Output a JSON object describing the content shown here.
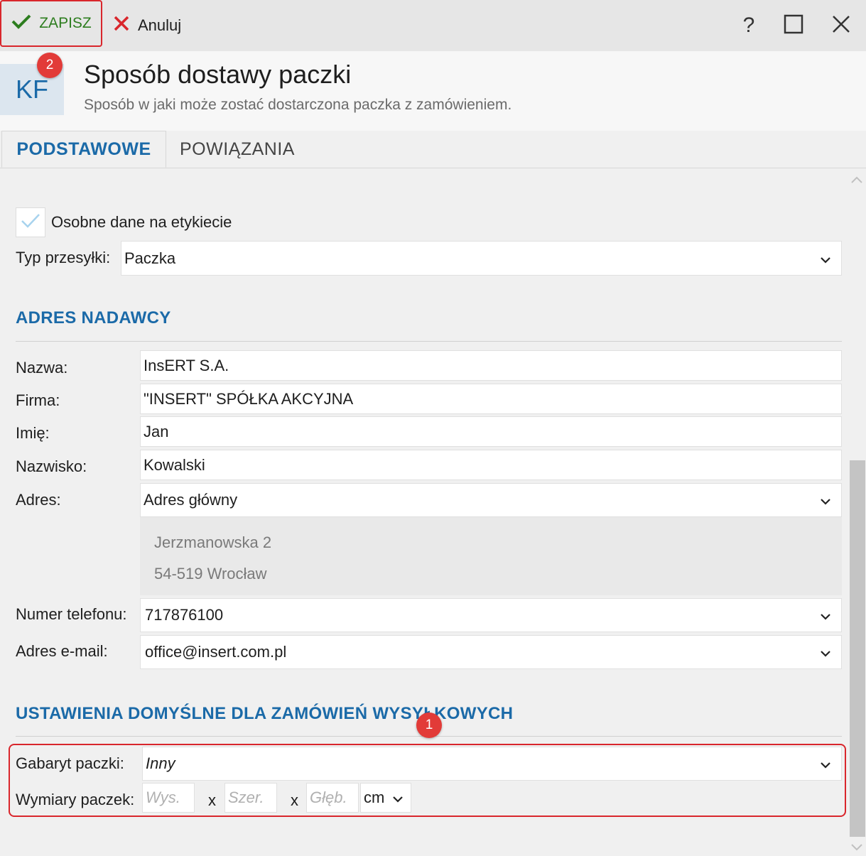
{
  "toolbar": {
    "save_label": "ZAPISZ",
    "cancel_label": "Anuluj"
  },
  "window_controls": {
    "help": "?"
  },
  "header": {
    "avatar_text": "KF",
    "title": "Sposób dostawy paczki",
    "subtitle": "Sposób w jaki może zostać dostarczona paczka z zamówieniem."
  },
  "badges": {
    "save_badge": "2",
    "section_badge": "1"
  },
  "tabs": [
    {
      "label": "PODSTAWOWE",
      "active": true
    },
    {
      "label": "POWIĄZANIA",
      "active": false
    }
  ],
  "general": {
    "separate_data_label": "Osobne dane na etykiecie",
    "separate_data_checked": true,
    "shipment_type_label": "Typ przesyłki:",
    "shipment_type_value": "Paczka"
  },
  "sender": {
    "section_title": "ADRES NADAWCY",
    "name_label": "Nazwa:",
    "name_value": "InsERT S.A.",
    "company_label": "Firma:",
    "company_value": "\"INSERT\" SPÓŁKA AKCYJNA",
    "first_name_label": "Imię:",
    "first_name_value": "Jan",
    "last_name_label": "Nazwisko:",
    "last_name_value": "Kowalski",
    "address_label": "Adres:",
    "address_value": "Adres główny",
    "address_line1": "Jerzmanowska 2",
    "address_line2": "54-519 Wrocław",
    "phone_label": "Numer telefonu:",
    "phone_value": "717876100",
    "email_label": "Adres e-mail:",
    "email_value": "office@insert.com.pl"
  },
  "defaults": {
    "section_title": "USTAWIENIA DOMYŚLNE DLA ZAMÓWIEŃ WYSYŁKOWYCH",
    "size_label": "Gabaryt paczki:",
    "size_value": "Inny",
    "dimensions_label": "Wymiary paczek:",
    "height_placeholder": "Wys.",
    "width_placeholder": "Szer.",
    "depth_placeholder": "Głęb.",
    "separator": "x",
    "unit_value": "cm"
  },
  "colors": {
    "accent": "#1b6aa8",
    "save_green": "#2d7d1f",
    "cancel_red": "#d9262c",
    "highlight_red": "#d9262c"
  }
}
